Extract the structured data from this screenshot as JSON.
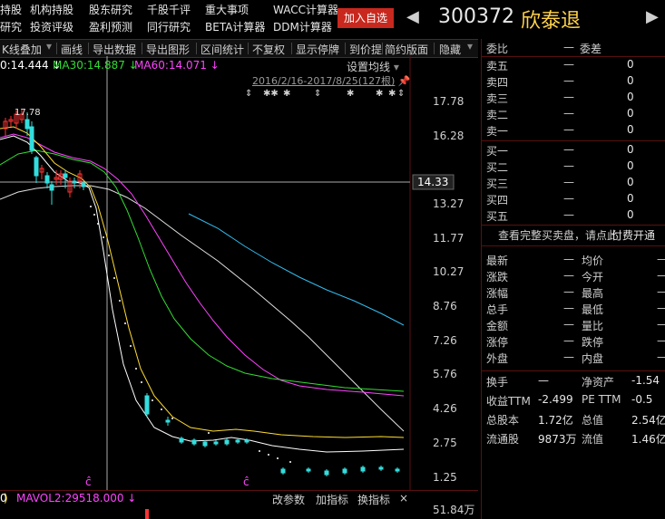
{
  "top_menu": {
    "row1": [
      "持股",
      "机构持股",
      "股东研究",
      "千股千评",
      "重大事项",
      "WACC计算器"
    ],
    "row2": [
      "研究",
      "投资评级",
      "盈利预测",
      "同行研究",
      "BETA计算器",
      "DDM计算器"
    ]
  },
  "add_watchlist_label": "加入自选",
  "nav": {
    "prev": "◀",
    "next": "▶"
  },
  "stock": {
    "code": "300372",
    "name": "欣泰退"
  },
  "toolbar": [
    "K线叠加",
    "画线",
    "导出数据",
    "导出图形",
    "区间统计",
    "不复权",
    "显示停牌",
    "到价提",
    "简约版面",
    "隐藏"
  ],
  "ma_row": {
    "ma10": "0:14.444 ↓",
    "ma30": "MA30:14.887 ↓",
    "ma60": "MA60:14.071 ↓",
    "settings": "设置均线"
  },
  "date_range": "2016/2/16-2017/8/25(127根)",
  "price_axis": [
    "17.78",
    "16.28",
    "14.33",
    "13.27",
    "11.77",
    "10.27",
    "8.76",
    "7.26",
    "5.76",
    "4.26",
    "2.75",
    "1.25"
  ],
  "current_price": "14.33",
  "peak_label": "17.78",
  "markers": [
    "ĉ",
    "ĉ"
  ],
  "volume_bar": {
    "mavol2": "MAVOL2:29518.000 ↓",
    "left_fragment": "0",
    "buttons": [
      "改参数",
      "加指标",
      "换指标",
      "×"
    ],
    "axis": "51.84万"
  },
  "order_book": {
    "header": {
      "weibi": "委比",
      "weicha_label": "委差",
      "weibi_val": "—",
      "weicha_val": ""
    },
    "sells": [
      {
        "label": "卖五",
        "price": "—",
        "vol": "0"
      },
      {
        "label": "卖四",
        "price": "—",
        "vol": "0"
      },
      {
        "label": "卖三",
        "price": "—",
        "vol": "0"
      },
      {
        "label": "卖二",
        "price": "—",
        "vol": "0"
      },
      {
        "label": "卖一",
        "price": "—",
        "vol": "0"
      }
    ],
    "buys": [
      {
        "label": "买一",
        "price": "—",
        "vol": "0"
      },
      {
        "label": "买二",
        "price": "—",
        "vol": "0"
      },
      {
        "label": "买三",
        "price": "—",
        "vol": "0"
      },
      {
        "label": "买四",
        "price": "—",
        "vol": "0"
      },
      {
        "label": "买五",
        "price": "—",
        "vol": "0"
      }
    ],
    "full_book_text": "查看完整买卖盘，请点此",
    "full_book_link": "付费开通"
  },
  "quote_stats": [
    {
      "l1": "最新",
      "v1": "—",
      "l2": "均价",
      "v2": "—"
    },
    {
      "l1": "涨跌",
      "v1": "—",
      "l2": "今开",
      "v2": "—"
    },
    {
      "l1": "涨幅",
      "v1": "—",
      "l2": "最高",
      "v2": "—"
    },
    {
      "l1": "总手",
      "v1": "—",
      "l2": "最低",
      "v2": "—"
    },
    {
      "l1": "金额",
      "v1": "—",
      "l2": "量比",
      "v2": "—"
    },
    {
      "l1": "涨停",
      "v1": "—",
      "l2": "跌停",
      "v2": "—"
    },
    {
      "l1": "外盘",
      "v1": "—",
      "l2": "内盘",
      "v2": "—"
    }
  ],
  "fundamentals": [
    {
      "l1": "换手",
      "v1": "—",
      "l2": "净资产",
      "v2": "-1.54"
    },
    {
      "l1": "收益TTM",
      "v1": "-2.499",
      "l2": "PE TTM",
      "v2": "-0.5"
    },
    {
      "l1": "总股本",
      "v1": "1.72亿",
      "l2": "总值",
      "v2": "2.54亿"
    },
    {
      "l1": "流通股",
      "v1": "9873万",
      "l2": "流值",
      "v2": "1.46亿"
    }
  ],
  "colors": {
    "ma10": "#ffffff",
    "ma30": "#33dd33",
    "ma60": "#ff44ff",
    "accent": "#c8281e",
    "name": "#ffd24a"
  }
}
